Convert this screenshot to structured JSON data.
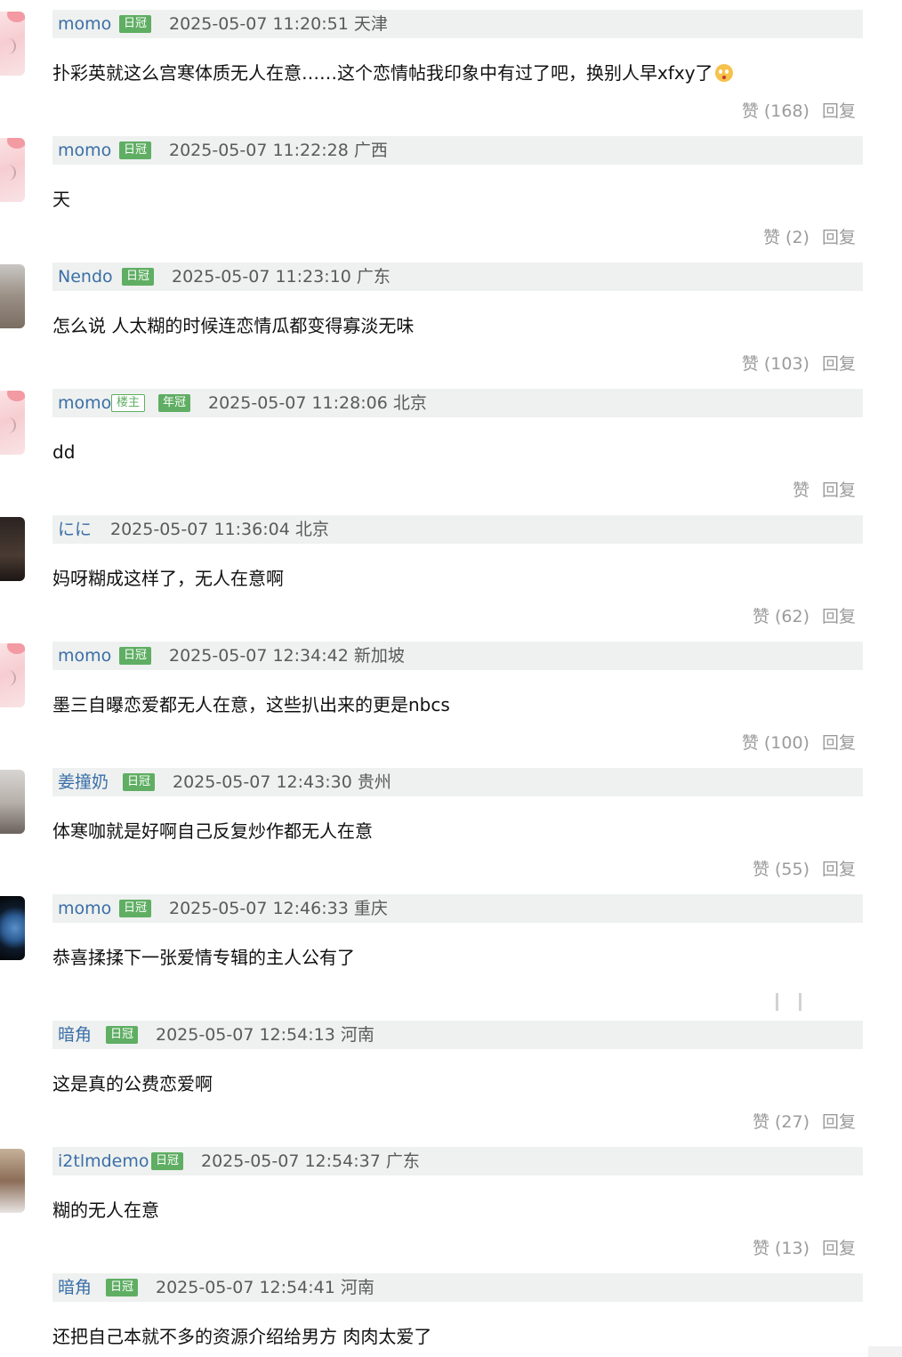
{
  "comments": [
    {
      "username": "momo",
      "badges": [
        "日冠"
      ],
      "timestamp": "2025-05-07 11:20:51 天津",
      "content": "扑彩英就这么宫寒体质无人在意……这个恋情帖我印象中有过了吧，换别人早xfxy了",
      "emoji": "flushed-face-icon",
      "like_label": "赞 (168)",
      "reply_label": "回复"
    },
    {
      "username": "momo",
      "badges": [
        "日冠"
      ],
      "timestamp": "2025-05-07 11:22:28 广西",
      "content": "天",
      "like_label": "赞 (2)",
      "reply_label": "回复"
    },
    {
      "username": "Nendo",
      "badges": [
        "日冠"
      ],
      "timestamp": "2025-05-07 11:23:10 广东",
      "content": "怎么说 人太糊的时候连恋情瓜都变得寡淡无味",
      "like_label": "赞 (103)",
      "reply_label": "回复"
    },
    {
      "username": "momo",
      "badges": [
        "楼主",
        "年冠"
      ],
      "timestamp": "2025-05-07 11:28:06 北京",
      "content": "dd",
      "like_label": "赞",
      "reply_label": "回复"
    },
    {
      "username": "にに",
      "badges": [],
      "timestamp": "2025-05-07 11:36:04 北京",
      "content": "妈呀糊成这样了，无人在意啊",
      "like_label": "赞 (62)",
      "reply_label": "回复"
    },
    {
      "username": "momo",
      "badges": [
        "日冠"
      ],
      "timestamp": "2025-05-07 12:34:42 新加坡",
      "content": "墨三自曝恋爱都无人在意，这些扒出来的更是nbcs",
      "like_label": "赞 (100)",
      "reply_label": "回复"
    },
    {
      "username": "姜撞奶",
      "badges": [
        "日冠"
      ],
      "timestamp": "2025-05-07 12:43:30 贵州",
      "content": "体寒咖就是好啊自己反复炒作都无人在意",
      "like_label": "赞 (55)",
      "reply_label": "回复"
    },
    {
      "username": "momo",
      "badges": [
        "日冠"
      ],
      "timestamp": "2025-05-07 12:46:33 重庆",
      "content": "恭喜揉揉下一张爱情专辑的主人公有了"
    },
    {
      "username": "暗角",
      "badges": [
        "日冠"
      ],
      "timestamp": "2025-05-07 12:54:13 河南",
      "content": "这是真的公费恋爱啊",
      "like_label": "赞 (27)",
      "reply_label": "回复"
    },
    {
      "username": "i2tlmdemo",
      "badges": [
        "日冠"
      ],
      "timestamp": "2025-05-07 12:54:37 广东",
      "content": "糊的无人在意",
      "like_label": "赞 (13)",
      "reply_label": "回复"
    },
    {
      "username": "暗角",
      "badges": [
        "日冠"
      ],
      "timestamp": "2025-05-07 12:54:41 河南",
      "content": "还把自己本就不多的资源介绍给男方 肉肉太爱了"
    }
  ],
  "colors": {
    "username": "#3b6ea8",
    "badge": "#5fae63",
    "meta_bar": "#eef1ef",
    "muted_text": "#9b9b9b"
  }
}
